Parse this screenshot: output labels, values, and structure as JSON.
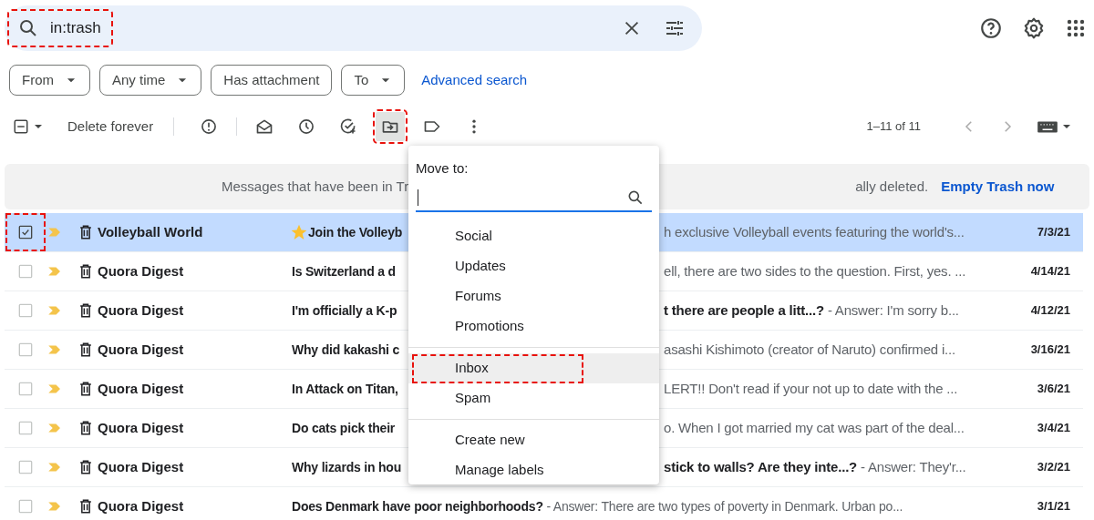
{
  "search": {
    "query": "in:trash",
    "highlighted": true
  },
  "filters": [
    {
      "label": "From",
      "dropdown": true
    },
    {
      "label": "Any time",
      "dropdown": true
    },
    {
      "label": "Has attachment",
      "dropdown": false
    },
    {
      "label": "To",
      "dropdown": true
    }
  ],
  "advanced_search": "Advanced search",
  "toolbar": {
    "delete_label": "Delete forever",
    "actions": [
      {
        "kind": "report",
        "highlighted": false
      },
      {
        "kind": "mark-read",
        "highlighted": false
      },
      {
        "kind": "snooze",
        "highlighted": false
      },
      {
        "kind": "add-task",
        "highlighted": false
      },
      {
        "kind": "move",
        "highlighted": true
      },
      {
        "kind": "label",
        "highlighted": false
      },
      {
        "kind": "more",
        "highlighted": false
      }
    ],
    "pagination": "1–11 of 11"
  },
  "banner": {
    "text_start": "Messages that have been in Tr",
    "text_end": "ally deleted.",
    "action": "Empty Trash now"
  },
  "rows": [
    {
      "selected": true,
      "highlighted": true,
      "starred": true,
      "sender": "Volleyball World",
      "subject": "**Join the Volleyb**",
      "tail": "h exclusive Volleyball events featuring the world's...",
      "date": "7/3/21"
    },
    {
      "selected": false,
      "highlighted": false,
      "starred": false,
      "sender": "Quora Digest",
      "subject": "**Is Switzerland a d**",
      "tail": "ell, there are two sides to the question. First, yes. ...",
      "date": "4/14/21"
    },
    {
      "selected": false,
      "highlighted": false,
      "starred": false,
      "sender": "Quora Digest",
      "subject": "**I'm officially a K-p**",
      "tail": "**t there are people a litt...?** - Answer: I'm sorry b...",
      "date": "4/12/21"
    },
    {
      "selected": false,
      "highlighted": false,
      "starred": false,
      "sender": "Quora Digest",
      "subject": "**Why did kakashi c**",
      "tail": "asashi Kishimoto (creator of Naruto) confirmed i...",
      "date": "3/16/21"
    },
    {
      "selected": false,
      "highlighted": false,
      "starred": false,
      "sender": "Quora Digest",
      "subject": "**In Attack on Titan,**",
      "tail": "LERT!! Don't read if your not up to date with the ...",
      "date": "3/6/21"
    },
    {
      "selected": false,
      "highlighted": false,
      "starred": false,
      "sender": "Quora Digest",
      "subject": "**Do cats pick their**",
      "tail": "o. When I got married my cat was part of the deal...",
      "date": "3/4/21"
    },
    {
      "selected": false,
      "highlighted": false,
      "starred": false,
      "sender": "Quora Digest",
      "subject": "**Why lizards in hou**",
      "tail": "**stick to walls? Are they inte...?** - Answer: They'r...",
      "date": "3/2/21"
    },
    {
      "selected": false,
      "highlighted": false,
      "starred": false,
      "sender": "Quora Digest",
      "subject": "**Does Denmark have poor neighborhoods?** - Answer: There are two types of poverty in Denmark. Urban po...",
      "date": "3/1/21"
    }
  ],
  "menu": {
    "title": "Move to:",
    "groups": [
      [
        {
          "label": "Social",
          "hovered": false,
          "highlighted": false
        },
        {
          "label": "Updates",
          "hovered": false,
          "highlighted": false
        },
        {
          "label": "Forums",
          "hovered": false,
          "highlighted": false
        },
        {
          "label": "Promotions",
          "hovered": false,
          "highlighted": false
        }
      ],
      [
        {
          "label": "Inbox",
          "hovered": true,
          "highlighted": true
        },
        {
          "label": "Spam",
          "hovered": false,
          "highlighted": false
        }
      ],
      [
        {
          "label": "Create new",
          "hovered": false,
          "highlighted": false
        },
        {
          "label": "Manage labels",
          "hovered": false,
          "highlighted": false
        }
      ]
    ]
  }
}
